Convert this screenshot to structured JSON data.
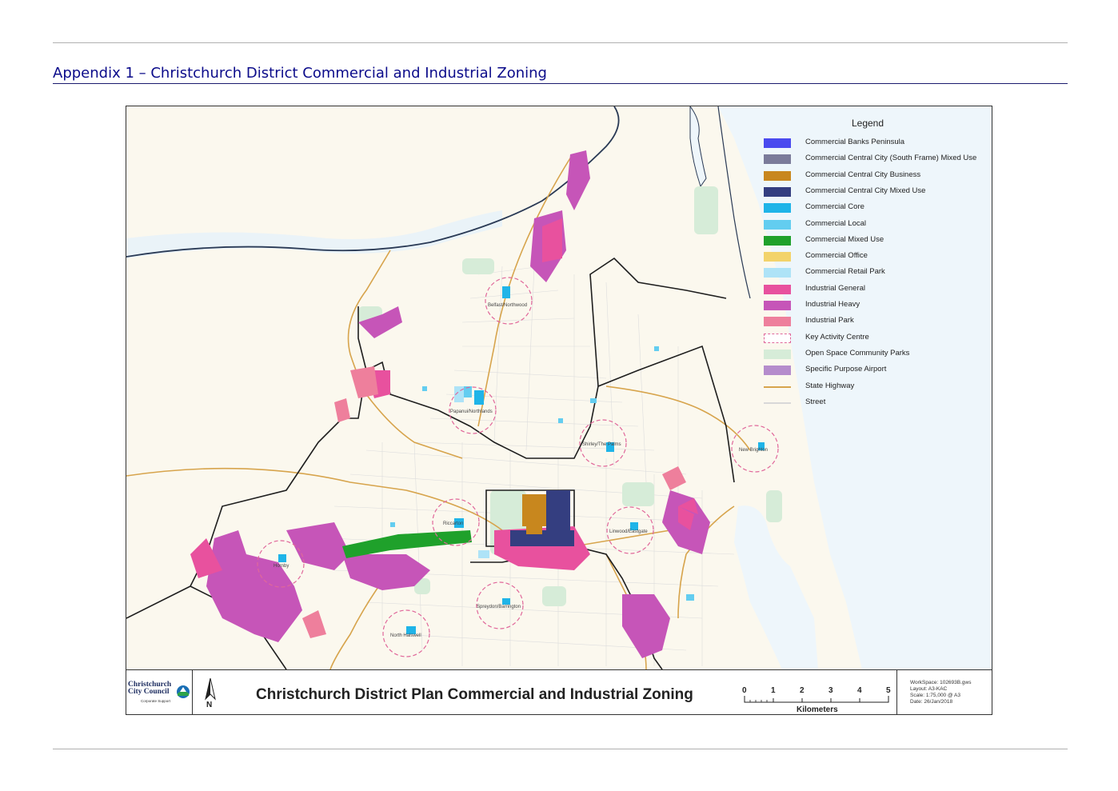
{
  "document": {
    "heading": "Appendix 1 – Christchurch District Commercial and Industrial Zoning"
  },
  "legend": {
    "title": "Legend",
    "items": [
      {
        "label": "Commercial Banks Peninsula",
        "color": "#4a4aef",
        "style": "fill"
      },
      {
        "label": "Commercial Central City (South Frame) Mixed Use",
        "color": "#7b7b9a",
        "style": "fill"
      },
      {
        "label": "Commercial Central City Business",
        "color": "#c8871e",
        "style": "fill"
      },
      {
        "label": "Commercial Central City Mixed Use",
        "color": "#343e80",
        "style": "fill"
      },
      {
        "label": "Commercial Core",
        "color": "#1fb4e8",
        "style": "fill"
      },
      {
        "label": "Commercial Local",
        "color": "#63cdf0",
        "style": "fill"
      },
      {
        "label": "Commercial Mixed Use",
        "color": "#1fa12b",
        "style": "fill"
      },
      {
        "label": "Commercial Office",
        "color": "#f3d36a",
        "style": "fill"
      },
      {
        "label": "Commercial Retail Park",
        "color": "#aee3f7",
        "style": "fill"
      },
      {
        "label": "Industrial General",
        "color": "#e8519e",
        "style": "fill"
      },
      {
        "label": "Industrial Heavy",
        "color": "#c655b8",
        "style": "fill"
      },
      {
        "label": "Industrial Park",
        "color": "#ee7f9c",
        "style": "fill"
      },
      {
        "label": "Key Activity Centre",
        "color": "#e0679a",
        "style": "dashed"
      },
      {
        "label": "Open Space Community Parks",
        "color": "#d6ecd8",
        "style": "fill"
      },
      {
        "label": "Specific Purpose Airport",
        "color": "#b58ccc",
        "style": "fill"
      },
      {
        "label": "State Highway",
        "color": "#d7a44c",
        "style": "line"
      },
      {
        "label": "Street",
        "color": "#d8d8d8",
        "style": "line"
      }
    ]
  },
  "places": [
    "Belfast/Northwood",
    "Papanui/Northlands",
    "Shirley/The Palms",
    "New Brighton",
    "Riccarton",
    "Linwood/Eastgate",
    "Hornby",
    "Spreydon/Barrington",
    "North Halswell"
  ],
  "titlebar": {
    "org_name_line1": "Christchurch",
    "org_name_line2": "City Council",
    "org_sub": "Corporate Support",
    "north_letter": "N",
    "title": "Christchurch District Plan Commercial and Industrial Zoning",
    "scale_ticks": [
      "0",
      "1",
      "2",
      "3",
      "4",
      "5"
    ],
    "scale_unit": "Kilometers",
    "info": {
      "workspace": "WorkSpace: 102693B.gws",
      "layout": "Layout: A3-KAC",
      "scale": "Scale: 1:75,000 @ A3",
      "date": "Date: 26/Jan/2018"
    }
  },
  "colors": {
    "heading": "#0b0b8a",
    "sea": "#eef6fb",
    "land": "#fbf8ee",
    "boundary": "#1e1e1e"
  }
}
